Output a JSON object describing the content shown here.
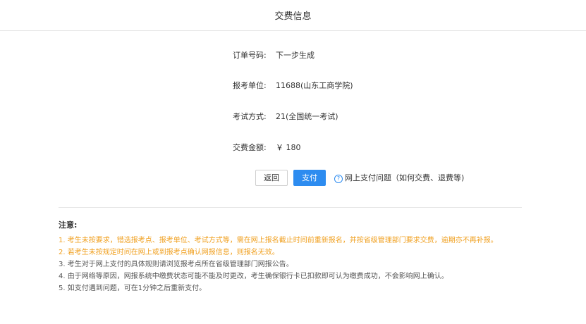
{
  "header": {
    "title": "交费信息"
  },
  "info": [
    {
      "label": "订单号码:",
      "value": "下一步生成"
    },
    {
      "label": "报考单位:",
      "value": "11688(山东工商学院)"
    },
    {
      "label": "考试方式:",
      "value": "21(全国统一考试)"
    },
    {
      "label": "交费金额:",
      "value": "￥ 180"
    }
  ],
  "actions": {
    "back_label": "返回",
    "pay_label": "支付",
    "help_label": "网上支付问题（如何交费、退费等)"
  },
  "notice": {
    "title": "注意:",
    "items": [
      {
        "text": "1. 考生未按要求，错选报考点、报考单位、考试方式等，需在网上报名截止时间前重新报名，并按省级管理部门要求交费，逾期亦不再补报。",
        "type": "warn"
      },
      {
        "text": "2. 若考生未按规定时间在网上或到报考点确认网报信息，则报名无效。",
        "type": "warn"
      },
      {
        "text": "3. 考生对于网上支付的具体规则请浏览报考点所在省级管理部门网报公告。",
        "type": "normal"
      },
      {
        "text": "4. 由于网络等原因，网报系统中缴费状态可能不能及时更改，考生确保银行卡已扣款即可认为缴费成功，不会影响网上确认。",
        "type": "normal"
      },
      {
        "text": "5. 如支付遇到问题，可在1分钟之后重新支付。",
        "type": "normal"
      }
    ]
  },
  "colors": {
    "accent": "#2d8cf0",
    "warning": "#f0a020"
  },
  "icons": {
    "help": "question-circle-icon"
  }
}
